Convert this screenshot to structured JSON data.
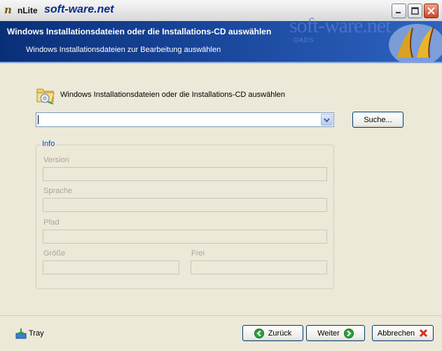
{
  "titlebar": {
    "app_name": "nLite",
    "watermark": "soft-ware.net"
  },
  "header": {
    "title": "Windows Installationsdateien oder die Installations-CD auswählen",
    "subtitle": "Windows Installationsdateien zur Bearbeitung auswählen",
    "watermark_big": "soft-ware.net",
    "watermark_small": "OADS"
  },
  "main": {
    "section_label": "Windows Installationsdateien oder die Installations-CD auswählen",
    "combo_value": "",
    "search_label": "Suche...",
    "info": {
      "legend": "Info",
      "version_label": "Version",
      "sprache_label": "Sprache",
      "pfad_label": "Pfad",
      "groesse_label": "Größe",
      "frei_label": "Frei"
    }
  },
  "bottom": {
    "tray_label": "Tray",
    "back_label": "Zurück",
    "next_label": "Weiter",
    "cancel_label": "Abbrechen"
  },
  "colors": {
    "header_blue": "#0A2F79",
    "accent_green": "#2E9E3A",
    "close_red": "#C8442A",
    "group_legend": "#0046D5"
  }
}
